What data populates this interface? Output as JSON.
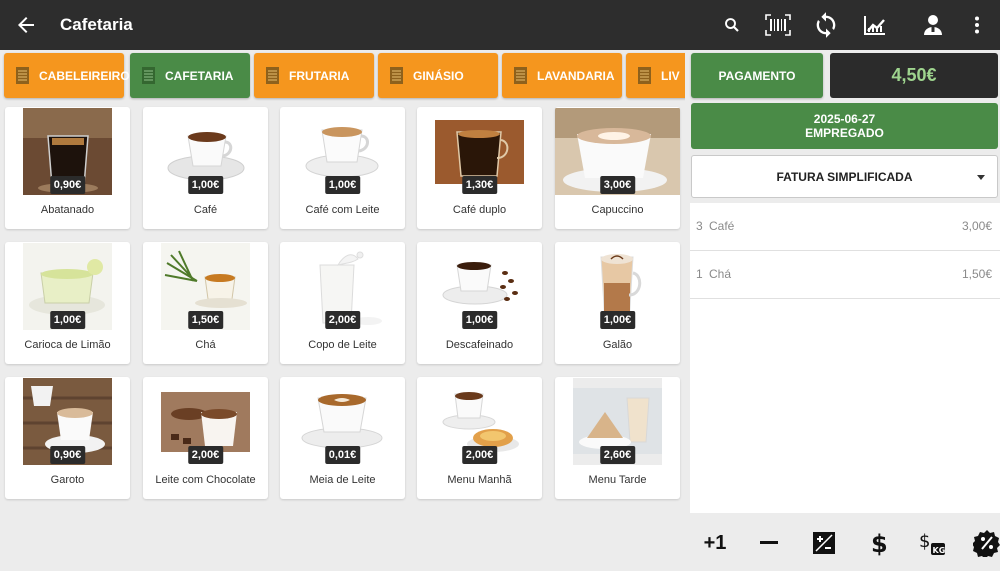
{
  "header": {
    "title": "Cafetaria",
    "icons": [
      "back-arrow-icon",
      "search-icon",
      "barcode-icon",
      "sync-icon",
      "chart-icon",
      "user-icon",
      "more-vert-icon"
    ]
  },
  "categories": [
    {
      "label": "CABELEIREIRO",
      "color": "#f5961e"
    },
    {
      "label": "CAFETARIA",
      "color": "#4a8b47"
    },
    {
      "label": "FRUTARIA",
      "color": "#f5961e"
    },
    {
      "label": "GINÁSIO",
      "color": "#f5961e"
    },
    {
      "label": "LAVANDARIA",
      "color": "#f5961e"
    },
    {
      "label": "LIV",
      "color": "#f5961e"
    }
  ],
  "products": [
    {
      "name": "Abatanado",
      "price": "0,90€"
    },
    {
      "name": "Café",
      "price": "1,00€"
    },
    {
      "name": "Café com Leite",
      "price": "1,00€"
    },
    {
      "name": "Café duplo",
      "price": "1,30€"
    },
    {
      "name": "Capuccino",
      "price": "3,00€"
    },
    {
      "name": "Carioca de Limão",
      "price": "1,00€"
    },
    {
      "name": "Chá",
      "price": "1,50€"
    },
    {
      "name": "Copo de Leite",
      "price": "2,00€"
    },
    {
      "name": "Descafeinado",
      "price": "1,00€"
    },
    {
      "name": "Galão",
      "price": "1,00€"
    },
    {
      "name": "Garoto",
      "price": "0,90€"
    },
    {
      "name": "Leite com Chocolate",
      "price": "2,00€"
    },
    {
      "name": "Meia de Leite",
      "price": "0,01€"
    },
    {
      "name": "Menu Manhã",
      "price": "2,00€"
    },
    {
      "name": "Menu Tarde",
      "price": "2,60€"
    }
  ],
  "panel": {
    "pay_label": "PAGAMENTO",
    "total": "4,50€",
    "date": "2025-06-27",
    "employee": "EMPREGADO",
    "doc_type": "FATURA SIMPLIFICADA",
    "lines": [
      {
        "qty": "3",
        "name": "Café",
        "value": "3,00€"
      },
      {
        "qty": "1",
        "name": "Chá",
        "value": "1,50€"
      }
    ]
  },
  "toolbar": {
    "plus_one": "+1",
    "icons": [
      "plus-one-icon",
      "minus-icon",
      "edit-price-icon",
      "dollar-icon",
      "dollar-weight-icon",
      "discount-icon"
    ]
  },
  "colors": {
    "topbar": "#2d2d2d",
    "orange": "#f5961e",
    "green": "#4a8b47",
    "total_text": "#9ed48e"
  }
}
